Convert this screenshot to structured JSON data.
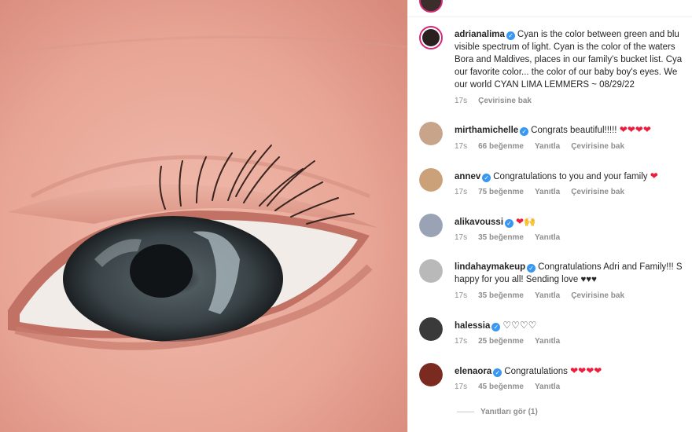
{
  "post": {
    "username": "adrianalima",
    "caption_lines": [
      "Cyan is the color between green and blu",
      "visible spectrum of light. Cyan is the color of the waters",
      "Bora and Maldives, places in our family's bucket list. Cya",
      "our favorite color... the color of our baby boy's eyes. We",
      "our world CYAN LIMA LEMMERS ~ 08/29/22"
    ],
    "time": "17s",
    "translate": "Çevirisine bak"
  },
  "comments": [
    {
      "username": "mirthamichelle",
      "text": "Congrats beautiful!!!!!",
      "emoji": "❤❤❤❤",
      "time": "17s",
      "likes": "66 beğenme",
      "reply": "Yanıtla",
      "translate": "Çevirisine bak",
      "avatar_color": "#c8a58a"
    },
    {
      "username": "annev",
      "text": "Congratulations to you and your family",
      "emoji": "❤",
      "time": "17s",
      "likes": "75 beğenme",
      "reply": "Yanıtla",
      "translate": "Çevirisine bak",
      "avatar_color": "#caa178"
    },
    {
      "username": "alikavoussi",
      "text": "",
      "emoji": "❤🙌",
      "time": "17s",
      "likes": "35 beğenme",
      "reply": "Yanıtla",
      "translate": "",
      "avatar_color": "#9aa3b5"
    },
    {
      "username": "lindahaymakeup",
      "text": "Congratulations Adri and Family!!! S",
      "text2": "happy for you all! Sending love ♥♥♥",
      "emoji": "",
      "time": "17s",
      "likes": "35 beğenme",
      "reply": "Yanıtla",
      "translate": "Çevirisine bak",
      "avatar_color": "#b9b9b9"
    },
    {
      "username": "halessia",
      "text": "",
      "emoji": "♡♡♡♡",
      "time": "17s",
      "likes": "25 beğenme",
      "reply": "Yanıtla",
      "translate": "",
      "avatar_color": "#3a3a3a"
    },
    {
      "username": "elenaora",
      "text": "Congratulations",
      "emoji": "❤❤❤❤",
      "time": "17s",
      "likes": "45 beğenme",
      "reply": "Yanıtla",
      "translate": "",
      "avatar_color": "#7a2a1f"
    }
  ],
  "view_replies": "Yanıtları gör (1)",
  "colors": {
    "verified": "#3897f0",
    "heart": "#ed1c3c",
    "story_ring": "#d62976"
  }
}
